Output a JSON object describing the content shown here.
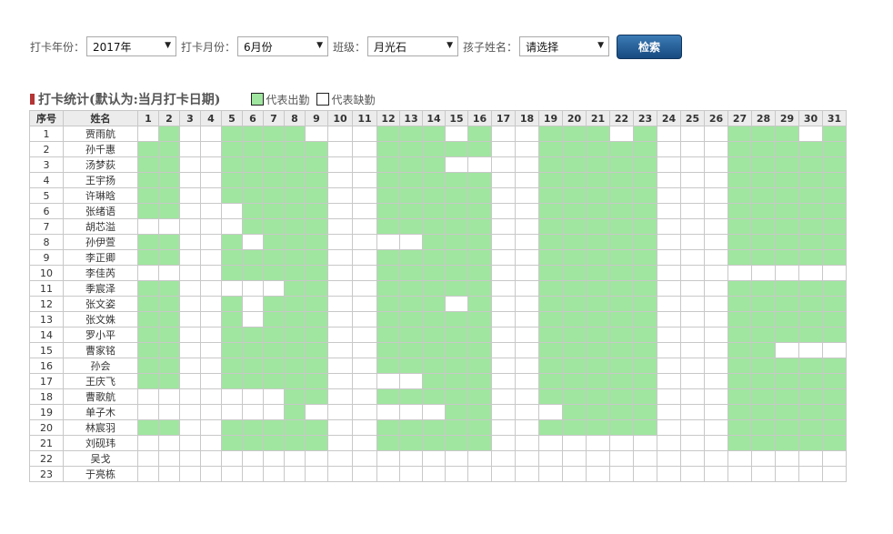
{
  "filters": {
    "year_label": "打卡年份：",
    "year_value": "2017年",
    "month_label": "打卡月份：",
    "month_value": "6月份",
    "class_label": "班级：",
    "class_value": "月光石",
    "child_label": "孩子姓名：",
    "child_value": "请选择",
    "search_label": "检索"
  },
  "section": {
    "title": "打卡统计(默认为:当月打卡日期)",
    "legend_present": "代表出勤",
    "legend_absent": "代表缺勤"
  },
  "colors": {
    "present": "#a0e6a0",
    "absent": "#ffffff",
    "accent": "#b43535",
    "button": "#1f5a92"
  },
  "table": {
    "col_seq": "序号",
    "col_name": "姓名",
    "days": [
      "1",
      "2",
      "3",
      "4",
      "5",
      "6",
      "7",
      "8",
      "9",
      "10",
      "11",
      "12",
      "13",
      "14",
      "15",
      "16",
      "17",
      "18",
      "19",
      "20",
      "21",
      "22",
      "23",
      "24",
      "25",
      "26",
      "27",
      "28",
      "29",
      "30",
      "31"
    ],
    "rows": [
      {
        "seq": "1",
        "name": "贾雨航",
        "att": "0100111100011101001110100011101"
      },
      {
        "seq": "2",
        "name": "孙千惠",
        "att": "1100111110011111001111100011111"
      },
      {
        "seq": "3",
        "name": "汤梦荻",
        "att": "1100111110011100001111100011111"
      },
      {
        "seq": "4",
        "name": "王宇扬",
        "att": "1100111110011111001111100011111"
      },
      {
        "seq": "5",
        "name": "许琳晗",
        "att": "1100111110011111001111100011111"
      },
      {
        "seq": "6",
        "name": "张绪语",
        "att": "1100011110011111001111100011111"
      },
      {
        "seq": "7",
        "name": "胡芯溢",
        "att": "0000011110011111001111100011111"
      },
      {
        "seq": "8",
        "name": "孙伊萱",
        "att": "1100101110000111001111100011111"
      },
      {
        "seq": "9",
        "name": "李正卿",
        "att": "1100111110011111001111100011111"
      },
      {
        "seq": "10",
        "name": "李佳芮",
        "att": "0000111110011111001111100000000"
      },
      {
        "seq": "11",
        "name": "季宸泽",
        "att": "1100000110011111001111100011111"
      },
      {
        "seq": "12",
        "name": "张文姿",
        "att": "1100101110011101001111100011111"
      },
      {
        "seq": "13",
        "name": "张文姝",
        "att": "1100101110011111001111100011111"
      },
      {
        "seq": "14",
        "name": "罗小平",
        "att": "1100111110011111001111100011111"
      },
      {
        "seq": "15",
        "name": "曹家铭",
        "att": "1100111110011111001111100011000"
      },
      {
        "seq": "16",
        "name": "孙会",
        "att": "1100111110011111001111100011111"
      },
      {
        "seq": "17",
        "name": "王庆飞",
        "att": "1100111110000111001111100011111"
      },
      {
        "seq": "18",
        "name": "曹歌航",
        "att": "0000000110011111001111100011111"
      },
      {
        "seq": "19",
        "name": "单子木",
        "att": "0000000100000011000111100011111"
      },
      {
        "seq": "20",
        "name": "林宸羽",
        "att": "1100111110011111001111100011111"
      },
      {
        "seq": "21",
        "name": "刘砚玮",
        "att": "0000111110011111000000000011111"
      },
      {
        "seq": "22",
        "name": "吴戈",
        "att": "0000000000000000000000000000000"
      },
      {
        "seq": "23",
        "name": "于亮栋",
        "att": "0000000000000000000000000000000"
      }
    ]
  }
}
